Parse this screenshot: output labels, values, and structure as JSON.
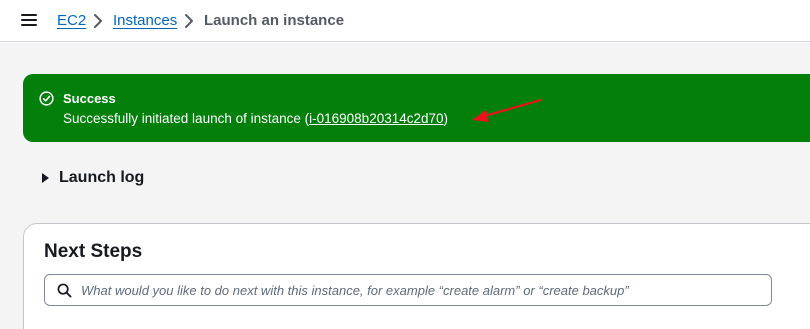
{
  "breadcrumb": {
    "items": [
      {
        "label": "EC2"
      },
      {
        "label": "Instances"
      },
      {
        "label": "Launch an instance"
      }
    ]
  },
  "flash": {
    "title": "Success",
    "message_prefix": "Successfully initiated launch of instance (",
    "instance_id": "i-016908b20314c2d70",
    "message_suffix": ")",
    "color": "#037f0c"
  },
  "launch_log": {
    "label": "Launch log"
  },
  "next_steps": {
    "heading": "Next Steps",
    "search_placeholder": "What would you like to do next with this instance, for example “create alarm” or “create backup”"
  },
  "annotation": {
    "arrow_color": "#e8141a"
  }
}
